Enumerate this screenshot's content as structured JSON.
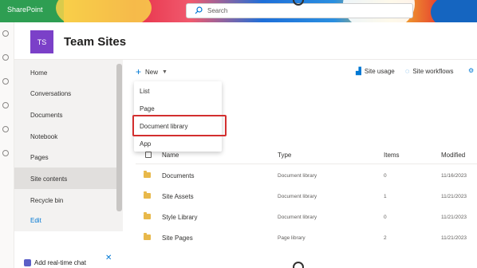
{
  "suitebar": {
    "app_name": "SharePoint",
    "search_placeholder": "Search"
  },
  "site": {
    "logo_initials": "TS",
    "title": "Team Sites"
  },
  "leftnav": {
    "items": [
      {
        "label": "Home"
      },
      {
        "label": "Conversations"
      },
      {
        "label": "Documents"
      },
      {
        "label": "Notebook"
      },
      {
        "label": "Pages"
      },
      {
        "label": "Site contents",
        "active": true
      },
      {
        "label": "Recycle bin"
      }
    ],
    "edit_label": "Edit"
  },
  "chat": {
    "label": "Add real-time chat",
    "close_symbol": "✕"
  },
  "commandbar": {
    "new_label": "New",
    "site_usage_label": "Site usage",
    "site_workflows_label": "Site workflows"
  },
  "new_menu": {
    "items": [
      {
        "label": "List"
      },
      {
        "label": "Page"
      },
      {
        "label": "Document library",
        "highlighted": true
      },
      {
        "label": "App"
      }
    ]
  },
  "table": {
    "headers": {
      "name": "Name",
      "type": "Type",
      "items": "Items",
      "modified": "Modified"
    },
    "rows": [
      {
        "name": "Documents",
        "type": "Document library",
        "items": "0",
        "modified": "11/16/2023"
      },
      {
        "name": "Site Assets",
        "type": "Document library",
        "items": "1",
        "modified": "11/21/2023"
      },
      {
        "name": "Style Library",
        "type": "Document library",
        "items": "0",
        "modified": "11/21/2023"
      },
      {
        "name": "Site Pages",
        "type": "Page library",
        "items": "2",
        "modified": "11/21/2023"
      }
    ]
  },
  "colors": {
    "accent": "#0078d4",
    "highlight_border": "#d32f2f",
    "site_logo": "#7b40c8"
  }
}
